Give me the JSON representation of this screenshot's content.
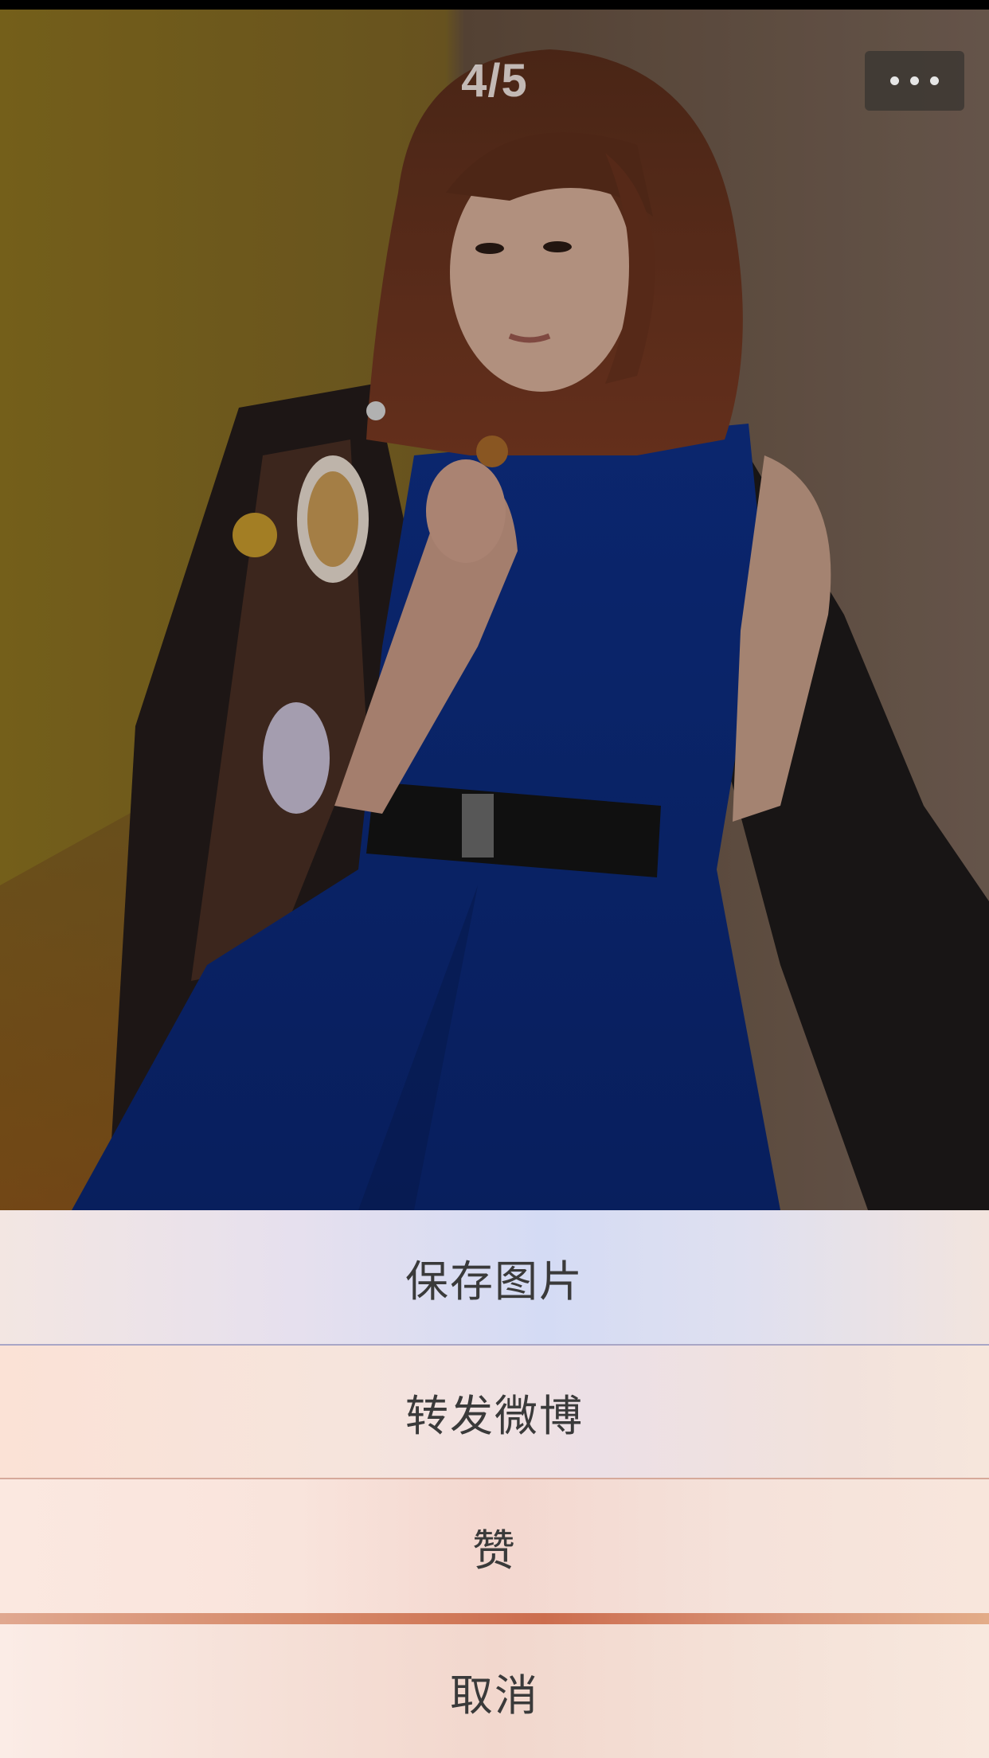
{
  "viewer": {
    "counter": "4/5",
    "more_icon": "ellipsis-icon"
  },
  "action_sheet": {
    "save_label": "保存图片",
    "forward_label": "转发微博",
    "like_label": "赞",
    "cancel_label": "取消"
  }
}
